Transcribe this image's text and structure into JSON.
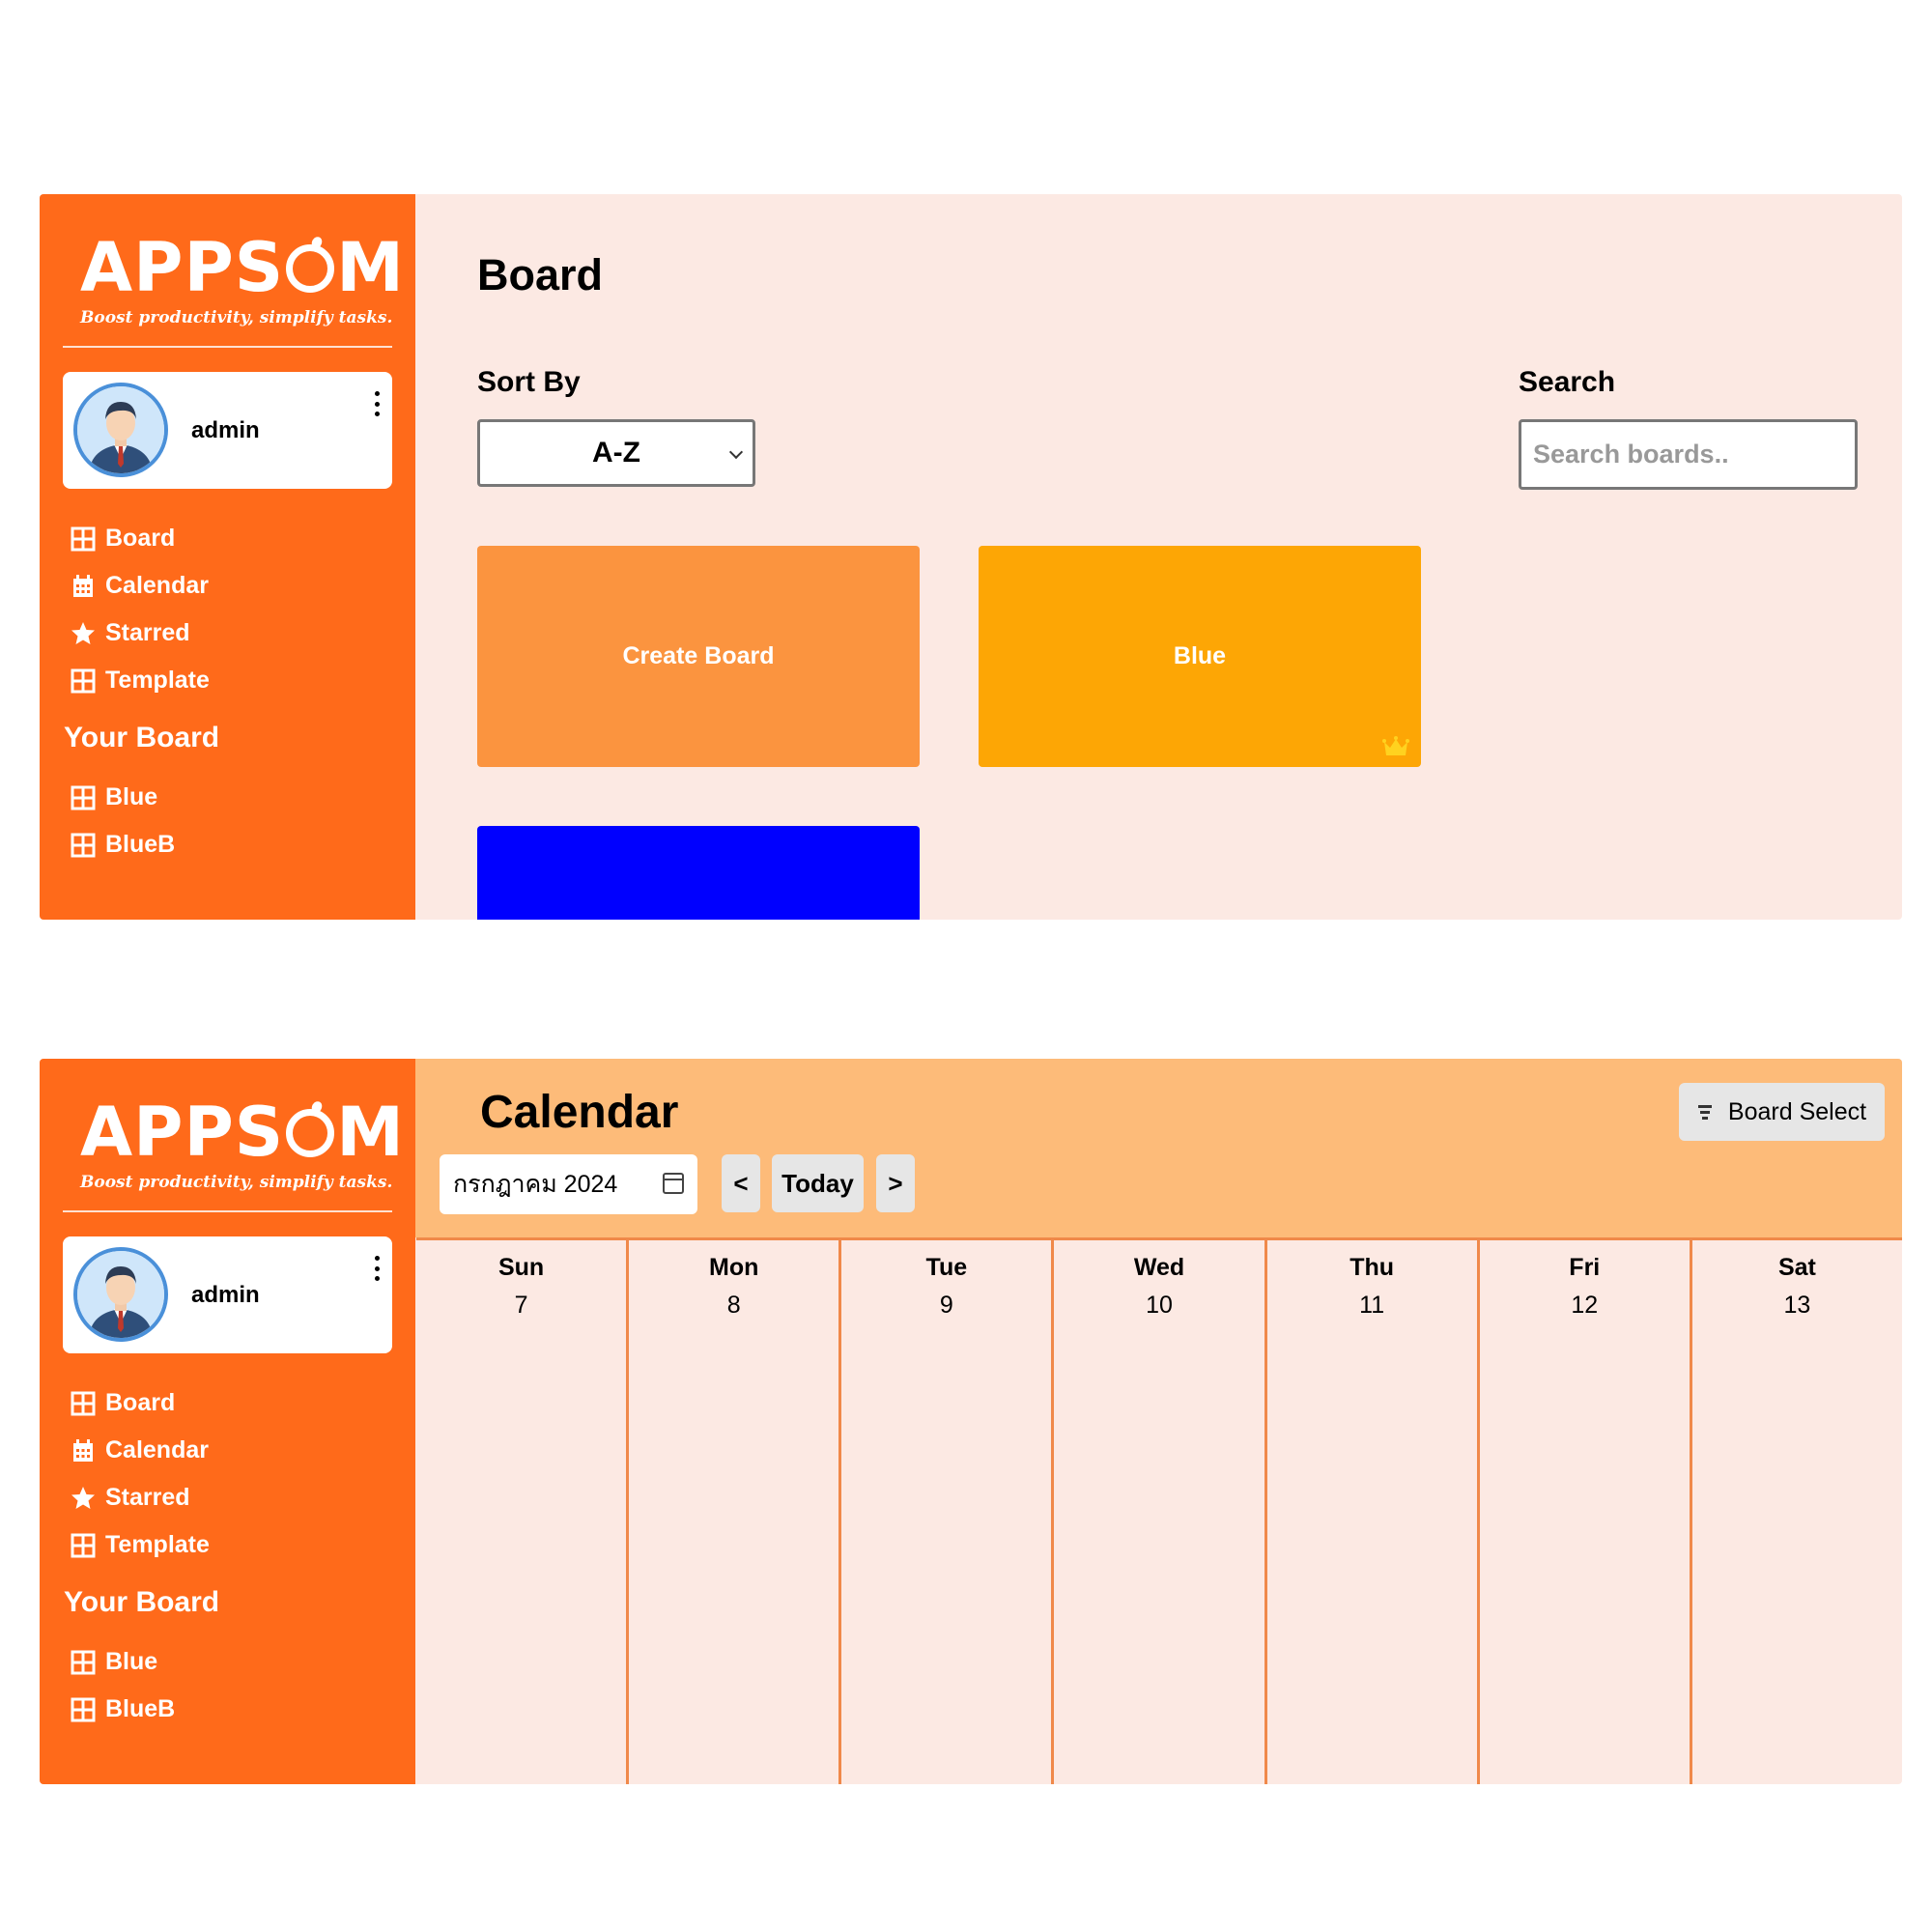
{
  "brand": {
    "logo_text_before": "APPS",
    "logo_text_after": "M",
    "tagline": "Boost productivity, simplify tasks."
  },
  "user": {
    "name": "admin"
  },
  "nav": {
    "items": [
      {
        "label": "Board",
        "icon": "grid-icon"
      },
      {
        "label": "Calendar",
        "icon": "calendar-icon"
      },
      {
        "label": "Starred",
        "icon": "star-icon"
      },
      {
        "label": "Template",
        "icon": "grid-icon"
      }
    ],
    "your_board_title": "Your Board",
    "your_boards": [
      {
        "label": "Blue",
        "icon": "grid-icon"
      },
      {
        "label": "BlueB",
        "icon": "grid-icon"
      }
    ]
  },
  "board_page": {
    "title": "Board",
    "sort_label": "Sort By",
    "sort_value": "A-Z",
    "search_label": "Search",
    "search_placeholder": "Search boards..",
    "cards": [
      {
        "label": "Create Board",
        "color": "#fb943f"
      },
      {
        "label": "Blue",
        "color": "#fda605",
        "starred": true
      },
      {
        "label": "",
        "color": "#0000ff"
      }
    ]
  },
  "calendar_page": {
    "title": "Calendar",
    "board_select_label": "Board Select",
    "month_value": "กรกฎาคม 2024",
    "prev_label": "<",
    "today_label": "Today",
    "next_label": ">",
    "days": [
      {
        "name": "Sun",
        "date": "7"
      },
      {
        "name": "Mon",
        "date": "8"
      },
      {
        "name": "Tue",
        "date": "9"
      },
      {
        "name": "Wed",
        "date": "10"
      },
      {
        "name": "Thu",
        "date": "11"
      },
      {
        "name": "Fri",
        "date": "12"
      },
      {
        "name": "Sat",
        "date": "13"
      }
    ]
  },
  "colors": {
    "sidebar": "#ff6a1a",
    "page_bg": "#fce9e3",
    "calendar_header": "#fdbb79",
    "crown": "#ffd21f"
  }
}
